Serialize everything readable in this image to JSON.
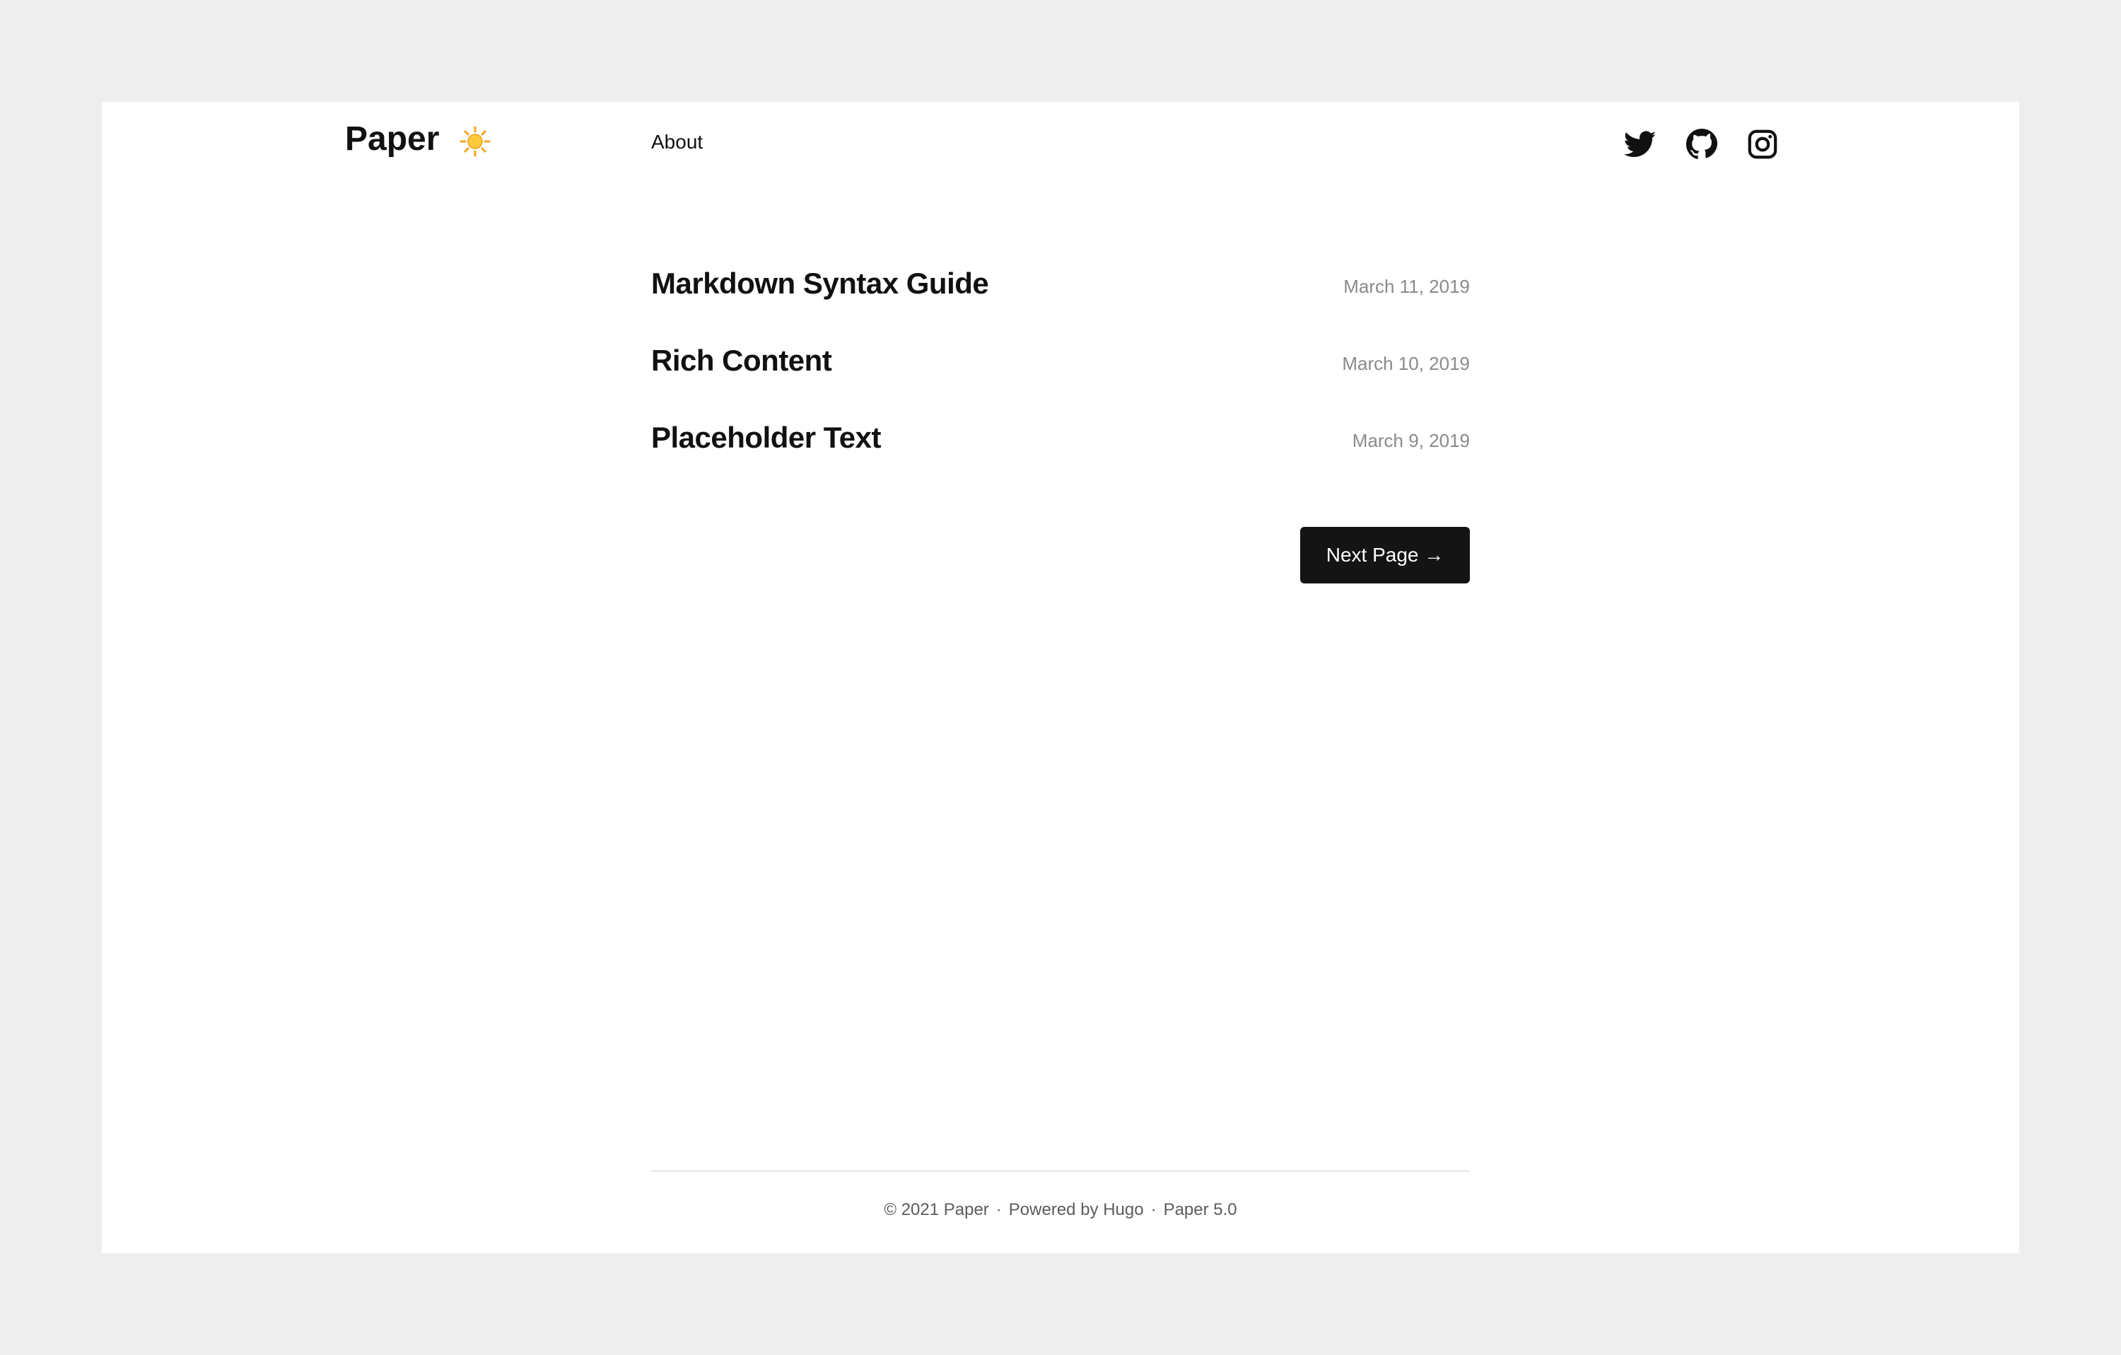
{
  "header": {
    "brand": "Paper",
    "theme_icon": "sun-icon",
    "nav": [
      {
        "label": "About"
      }
    ],
    "social": [
      {
        "name": "twitter",
        "icon": "twitter-icon"
      },
      {
        "name": "github",
        "icon": "github-icon"
      },
      {
        "name": "instagram",
        "icon": "instagram-icon"
      }
    ]
  },
  "posts": [
    {
      "title": "Markdown Syntax Guide",
      "date": "March 11, 2019"
    },
    {
      "title": "Rich Content",
      "date": "March 10, 2019"
    },
    {
      "title": "Placeholder Text",
      "date": "March 9, 2019"
    }
  ],
  "pagination": {
    "next_label": "Next Page →"
  },
  "footer": {
    "copyright": "© 2021 Paper",
    "powered_by": "Powered by Hugo",
    "version": "Paper 5.0",
    "separator": "·"
  },
  "colors": {
    "background": "#eeeeee",
    "surface": "#ffffff",
    "text": "#111111",
    "muted": "#8a8a8a",
    "button": "#141414"
  }
}
